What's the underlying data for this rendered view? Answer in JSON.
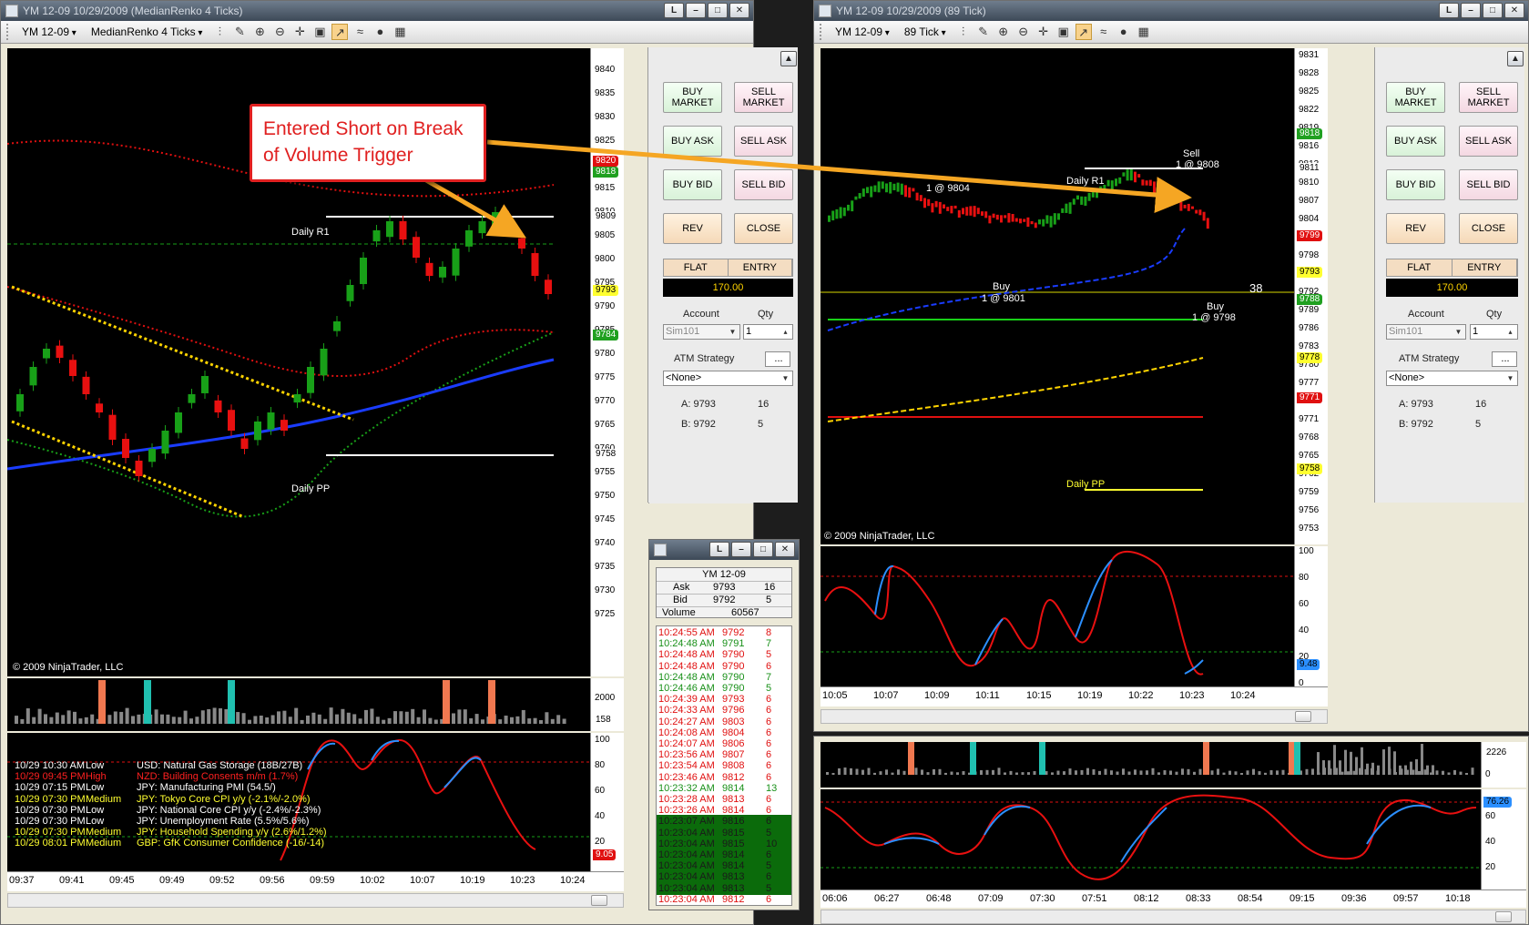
{
  "left_window": {
    "title": "YM 12-09  10/29/2009 (MedianRenko 4 Ticks)",
    "instrument": "YM 12-09",
    "period": "MedianRenko 4 Ticks",
    "copyright": "© 2009 NinjaTrader, LLC",
    "price_ticks": [
      "9840",
      "9835",
      "9830",
      "9825",
      "9820",
      "9815",
      "9810",
      "9805",
      "9800",
      "9795",
      "9790",
      "9785",
      "9780",
      "9775",
      "9770",
      "9765",
      "9760",
      "9755",
      "9750",
      "9745",
      "9740",
      "9735",
      "9730",
      "9725"
    ],
    "price_tags": [
      {
        "text": "9820",
        "color": "#e01010"
      },
      {
        "text": "9818",
        "color": "#20a020"
      },
      {
        "text": "9809",
        "color": "#ffffff"
      },
      {
        "text": "9793",
        "color": "#ffff30"
      },
      {
        "text": "9784",
        "color": "#20a020"
      },
      {
        "text": "9758",
        "color": "#ffffff"
      }
    ],
    "levels": {
      "r1": "Daily R1",
      "pp": "Daily PP"
    },
    "volume_ticks": [
      "2000"
    ],
    "volume_tag": "158",
    "osc_ticks": [
      "100",
      "80",
      "60",
      "40",
      "20"
    ],
    "osc_tag": "9.05",
    "time_ticks": [
      "09:37",
      "09:41",
      "09:45",
      "09:49",
      "09:52",
      "09:56",
      "09:59",
      "10:02",
      "10:07",
      "10:19",
      "10:23",
      "10:24"
    ]
  },
  "right_window": {
    "title": "YM 12-09  10/29/2009 (89 Tick)",
    "instrument": "YM 12-09",
    "period": "89 Tick",
    "copyright": "© 2009 NinjaTrader, LLC",
    "price_ticks": [
      "9831",
      "9828",
      "9825",
      "9822",
      "9819",
      "9816",
      "9813",
      "9810",
      "9807",
      "9804",
      "9801",
      "9798",
      "9795",
      "9792",
      "9789",
      "9786",
      "9783",
      "9780",
      "9777",
      "9774",
      "9771",
      "9768",
      "9765",
      "9762",
      "9759",
      "9756",
      "9753"
    ],
    "price_tags": [
      {
        "text": "9818",
        "color": "#20a020"
      },
      {
        "text": "9811",
        "color": "#ffffff"
      },
      {
        "text": "9799",
        "color": "#e01010"
      },
      {
        "text": "9793",
        "color": "#ffff30"
      },
      {
        "text": "9788",
        "color": "#20a020"
      },
      {
        "text": "9778",
        "color": "#ffff30"
      },
      {
        "text": "9771",
        "color": "#e01010"
      },
      {
        "text": "9758",
        "color": "#ffff30"
      }
    ],
    "annotations": {
      "sell": "Sell",
      "sell_fill": "1 @ 9808",
      "at9804": "1 @ 9804",
      "buy1": "Buy",
      "buy1_fill": "1 @ 9801",
      "buy2": "Buy",
      "buy2_fill": "1 @ 9798",
      "count": "38",
      "r1": "Daily R1",
      "pp": "Daily PP"
    },
    "osc_ticks": [
      "100",
      "80",
      "60",
      "40",
      "20",
      "0"
    ],
    "osc_tag": "9.48",
    "time_ticks": [
      "10:05",
      "10:07",
      "10:09",
      "10:11",
      "10:15",
      "10:19",
      "10:22",
      "10:23",
      "10:24"
    ]
  },
  "bottom_right": {
    "volume_ticks": [
      "0"
    ],
    "volume_tag": "2226",
    "osc_ticks": [
      "60",
      "40",
      "20"
    ],
    "osc_tag": "76.26",
    "time_ticks": [
      "06:06",
      "06:27",
      "06:48",
      "07:09",
      "07:30",
      "07:51",
      "08:12",
      "08:33",
      "08:54",
      "09:15",
      "09:36",
      "09:57",
      "10:18"
    ]
  },
  "order_panel": {
    "buy_market": "BUY MARKET",
    "sell_market": "SELL MARKET",
    "buy_ask": "BUY ASK",
    "sell_ask": "SELL ASK",
    "buy_bid": "BUY BID",
    "sell_bid": "SELL BID",
    "rev": "REV",
    "close": "CLOSE",
    "flat": "FLAT",
    "entry": "ENTRY",
    "pnl": "170.00",
    "account_label": "Account",
    "qty_label": "Qty",
    "account": "Sim101",
    "qty": "1",
    "atm_label": "ATM Strategy",
    "atm_value": "<None>",
    "atm_btn": "...",
    "ask_label": "A: 9793",
    "ask_size": "16",
    "bid_label": "B: 9792",
    "bid_size": "5"
  },
  "callout": {
    "text": "Entered Short on Break of Volume Trigger"
  },
  "time_sales": {
    "instrument": "YM 12-09",
    "ask_label": "Ask",
    "ask": "9793",
    "ask_size": "16",
    "bid_label": "Bid",
    "bid": "9792",
    "bid_size": "5",
    "volume_label": "Volume",
    "volume": "60567",
    "rows": [
      {
        "time": "10:24:55 AM",
        "price": "9792",
        "size": "8",
        "color": "red"
      },
      {
        "time": "10:24:48 AM",
        "price": "9791",
        "size": "7",
        "color": "green"
      },
      {
        "time": "10:24:48 AM",
        "price": "9790",
        "size": "5",
        "color": "red"
      },
      {
        "time": "10:24:48 AM",
        "price": "9790",
        "size": "6",
        "color": "red"
      },
      {
        "time": "10:24:48 AM",
        "price": "9790",
        "size": "7",
        "color": "green"
      },
      {
        "time": "10:24:46 AM",
        "price": "9790",
        "size": "5",
        "color": "green"
      },
      {
        "time": "10:24:39 AM",
        "price": "9793",
        "size": "6",
        "color": "red"
      },
      {
        "time": "10:24:33 AM",
        "price": "9796",
        "size": "6",
        "color": "red"
      },
      {
        "time": "10:24:27 AM",
        "price": "9803",
        "size": "6",
        "color": "red"
      },
      {
        "time": "10:24:08 AM",
        "price": "9804",
        "size": "6",
        "color": "red"
      },
      {
        "time": "10:24:07 AM",
        "price": "9806",
        "size": "6",
        "color": "red"
      },
      {
        "time": "10:23:56 AM",
        "price": "9807",
        "size": "6",
        "color": "red"
      },
      {
        "time": "10:23:54 AM",
        "price": "9808",
        "size": "6",
        "color": "red"
      },
      {
        "time": "10:23:46 AM",
        "price": "9812",
        "size": "6",
        "color": "red"
      },
      {
        "time": "10:23:32 AM",
        "price": "9814",
        "size": "13",
        "color": "green"
      },
      {
        "time": "10:23:28 AM",
        "price": "9813",
        "size": "6",
        "color": "red"
      },
      {
        "time": "10:23:26 AM",
        "price": "9814",
        "size": "6",
        "color": "red"
      },
      {
        "time": "10:23:07 AM",
        "price": "9816",
        "size": "6",
        "color": "hl"
      },
      {
        "time": "10:23:04 AM",
        "price": "9815",
        "size": "5",
        "color": "hl"
      },
      {
        "time": "10:23:04 AM",
        "price": "9815",
        "size": "10",
        "color": "hl"
      },
      {
        "time": "10:23:04 AM",
        "price": "9814",
        "size": "6",
        "color": "hl"
      },
      {
        "time": "10:23:04 AM",
        "price": "9814",
        "size": "5",
        "color": "hl"
      },
      {
        "time": "10:23:04 AM",
        "price": "9813",
        "size": "6",
        "color": "hl"
      },
      {
        "time": "10:23:04 AM",
        "price": "9813",
        "size": "5",
        "color": "hl"
      },
      {
        "time": "10:23:04 AM",
        "price": "9812",
        "size": "6",
        "color": "red"
      }
    ]
  },
  "news": [
    {
      "time": "10/29 10:30 AM",
      "impact": "Low",
      "event": "USD: Natural Gas Storage (18B/27B)",
      "color": "#ffffff"
    },
    {
      "time": "10/29 09:45 PM",
      "impact": "High",
      "event": "NZD: Building Consents m/m (1.7%)",
      "color": "#ff2020"
    },
    {
      "time": "10/29 07:15 PM",
      "impact": "Low",
      "event": "JPY: Manufacturing PMI (54.5/)",
      "color": "#ffffff"
    },
    {
      "time": "10/29 07:30 PM",
      "impact": "Medium",
      "event": "JPY: Tokyo Core CPI y/y (-2.1%/-2.0%)",
      "color": "#ffff30"
    },
    {
      "time": "10/29 07:30 PM",
      "impact": "Low",
      "event": "JPY: National Core CPI y/y (-2.4%/-2.3%)",
      "color": "#ffffff"
    },
    {
      "time": "10/29 07:30 PM",
      "impact": "Low",
      "event": "JPY: Unemployment Rate (5.5%/5.6%)",
      "color": "#ffffff"
    },
    {
      "time": "10/29 07:30 PM",
      "impact": "Medium",
      "event": "JPY: Household Spending y/y (2.6%/1.2%)",
      "color": "#ffff30"
    },
    {
      "time": "10/29 08:01 PM",
      "impact": "Medium",
      "event": "GBP: GfK Consumer Confidence (-16/-14)",
      "color": "#ffff30"
    }
  ],
  "colors": {
    "up": "#18a018",
    "down": "#e81010",
    "ema": "#1a3cff",
    "level": "#ffffff",
    "osc_up": "#2b8fff",
    "osc_down": "#e81010",
    "callout": "#e02020",
    "arrow": "#f5a623"
  }
}
